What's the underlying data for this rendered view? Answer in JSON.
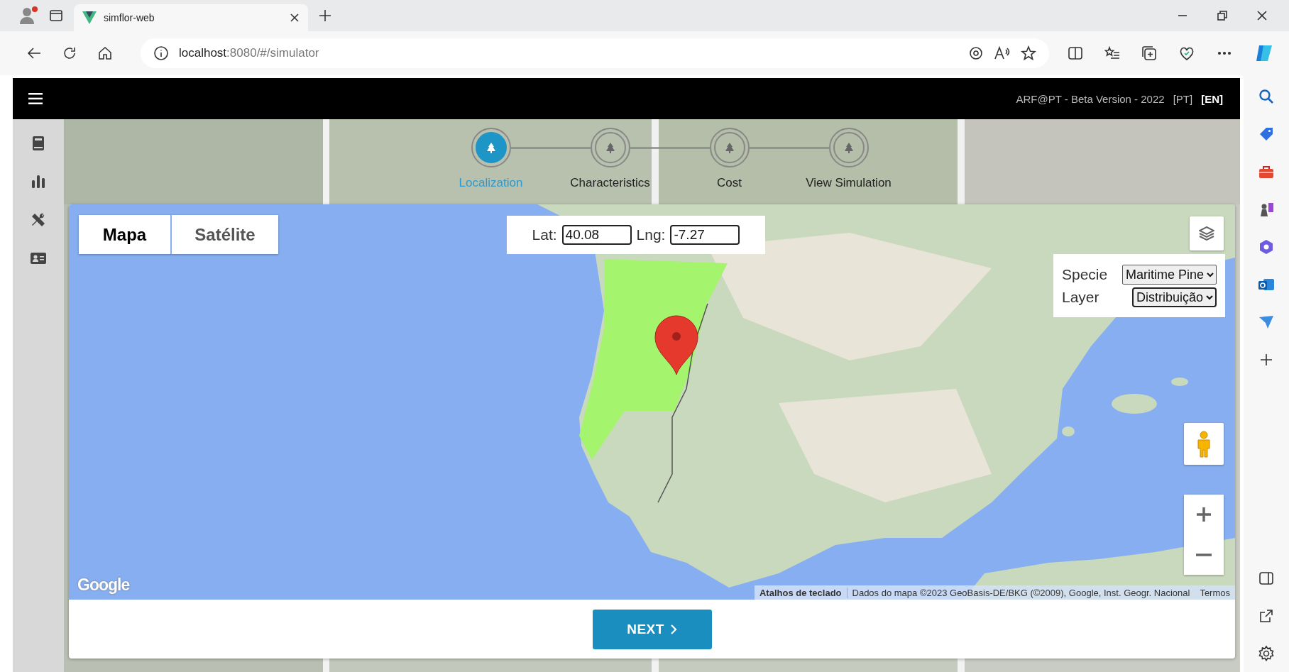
{
  "browser": {
    "tab_title": "simflor-web",
    "url_host": "localhost",
    "url_path": ":8080/#/simulator"
  },
  "header": {
    "title": "ARF@PT - Beta Version - 2022",
    "languages": [
      {
        "label": "[PT]",
        "selected": false
      },
      {
        "label": "[EN]",
        "selected": true
      }
    ]
  },
  "stepper": {
    "steps": [
      {
        "label": "Localization",
        "selected": true
      },
      {
        "label": "Characteristics",
        "selected": false
      },
      {
        "label": "Cost",
        "selected": false
      },
      {
        "label": "View Simulation",
        "selected": false
      }
    ]
  },
  "map": {
    "types": [
      {
        "label": "Mapa",
        "selected": true
      },
      {
        "label": "Satélite",
        "selected": false
      }
    ],
    "lat": {
      "label": "Lat:",
      "value": "40.08"
    },
    "lng": {
      "label": "Lng:",
      "value": "-7.27"
    },
    "specie": {
      "label": "Specie",
      "value": "Maritime Pine"
    },
    "layer": {
      "label": "Layer",
      "value": "Distribuição"
    },
    "logo": "Google",
    "attribution": {
      "shortcuts": "Atalhos de teclado",
      "data": "Dados do mapa ©2023 GeoBasis-DE/BKG (©2009), Google, Inst. Geogr. Nacional",
      "terms": "Termos"
    }
  },
  "next_button": "NEXT"
}
